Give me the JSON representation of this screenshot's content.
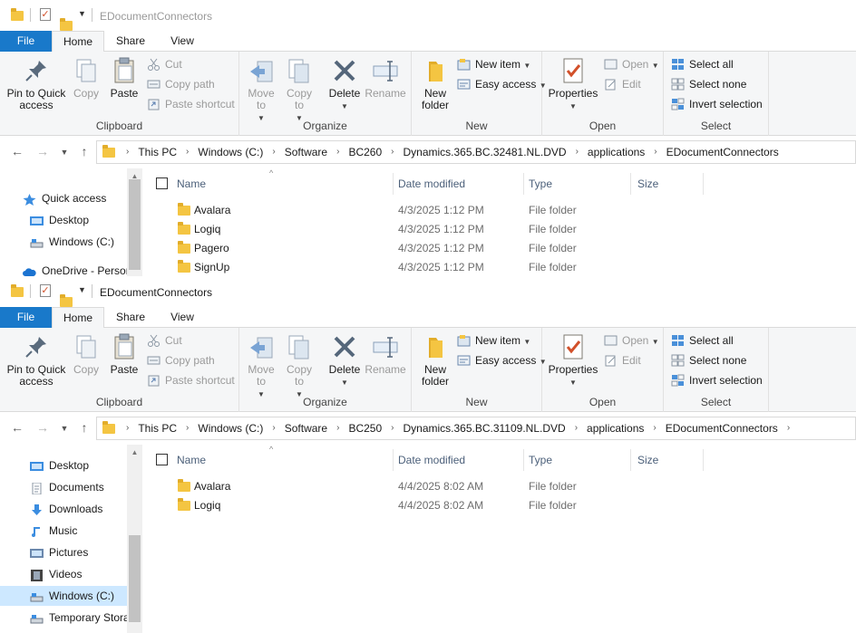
{
  "colors": {
    "file_tab": "#1979ca",
    "ribbon_bg": "#f5f6f7",
    "header_text": "#4c607a",
    "folder": "#f4c542",
    "selected_nav": "#cde8ff"
  },
  "ribbon": {
    "tabs": {
      "file": "File",
      "home": "Home",
      "share": "Share",
      "view": "View"
    },
    "clipboard": {
      "pin": "Pin to Quick access",
      "copy": "Copy",
      "paste": "Paste",
      "cut": "Cut",
      "copy_path": "Copy path",
      "paste_shortcut": "Paste shortcut",
      "label": "Clipboard"
    },
    "organize": {
      "move_to": "Move to",
      "copy_to": "Copy to",
      "delete": "Delete",
      "rename": "Rename",
      "label": "Organize"
    },
    "new": {
      "new_folder": "New folder",
      "new_item": "New item",
      "easy_access": "Easy access",
      "label": "New"
    },
    "open": {
      "properties": "Properties",
      "open": "Open",
      "edit": "Edit",
      "label": "Open"
    },
    "select": {
      "select_all": "Select all",
      "select_none": "Select none",
      "invert": "Invert selection",
      "label": "Select"
    }
  },
  "columns": {
    "name": "Name",
    "date": "Date modified",
    "type": "Type",
    "size": "Size"
  },
  "windows": [
    {
      "title": "EDocumentConnectors",
      "breadcrumb": [
        "This PC",
        "Windows (C:)",
        "Software",
        "BC260",
        "Dynamics.365.BC.32481.NL.DVD",
        "applications",
        "EDocumentConnectors"
      ],
      "nav": [
        "Quick access",
        "Desktop",
        "Windows (C:)",
        "OneDrive - Persor"
      ],
      "files": [
        {
          "name": "Avalara",
          "date": "4/3/2025 1:12 PM",
          "type": "File folder"
        },
        {
          "name": "Logiq",
          "date": "4/3/2025 1:12 PM",
          "type": "File folder"
        },
        {
          "name": "Pagero",
          "date": "4/3/2025 1:12 PM",
          "type": "File folder"
        },
        {
          "name": "SignUp",
          "date": "4/3/2025 1:12 PM",
          "type": "File folder"
        }
      ]
    },
    {
      "title": "EDocumentConnectors",
      "breadcrumb": [
        "This PC",
        "Windows (C:)",
        "Software",
        "BC250",
        "Dynamics.365.BC.31109.NL.DVD",
        "applications",
        "EDocumentConnectors"
      ],
      "nav": [
        "Desktop",
        "Documents",
        "Downloads",
        "Music",
        "Pictures",
        "Videos",
        "Windows (C:)",
        "Temporary Stora"
      ],
      "files": [
        {
          "name": "Avalara",
          "date": "4/4/2025 8:02 AM",
          "type": "File folder"
        },
        {
          "name": "Logiq",
          "date": "4/4/2025 8:02 AM",
          "type": "File folder"
        }
      ]
    }
  ]
}
